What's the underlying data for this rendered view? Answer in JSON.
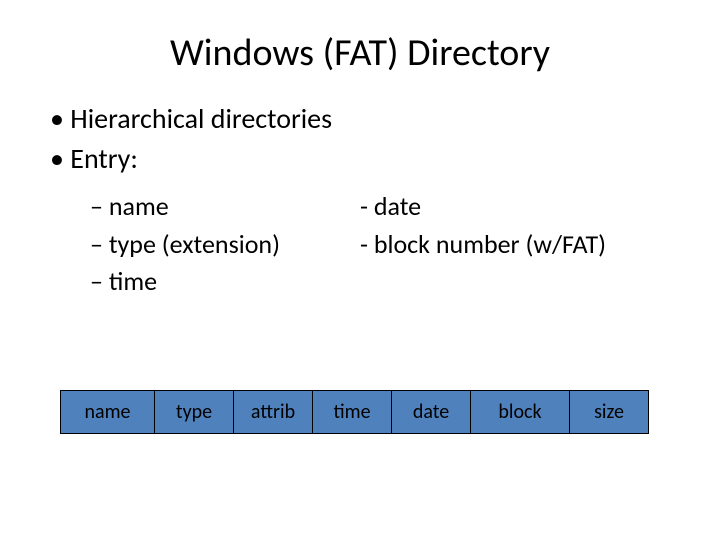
{
  "title": "Windows (FAT) Directory",
  "bullets": {
    "b1": "Hierarchical directories",
    "b2": "Entry:",
    "left": {
      "i1": "name",
      "i2": "type (extension)",
      "i3": "time"
    },
    "right": {
      "i1": "date",
      "i2": "block number (w/FAT)"
    }
  },
  "table": {
    "c1": "name",
    "c2": "type",
    "c3": "attrib",
    "c4": "time",
    "c5": "date",
    "c6": "block",
    "c7": "size"
  }
}
